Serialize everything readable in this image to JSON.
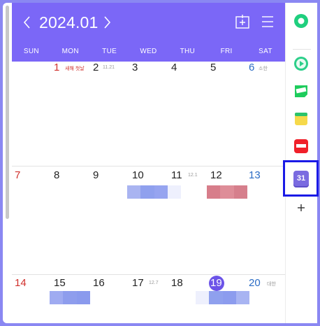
{
  "header": {
    "title": "2024.01",
    "weekdays": [
      "SUN",
      "MON",
      "TUE",
      "WED",
      "THU",
      "FRI",
      "SAT"
    ]
  },
  "weeks": [
    [
      {
        "num": "",
        "sub": ""
      },
      {
        "num": "1",
        "sub": "새해 첫날"
      },
      {
        "num": "2",
        "sub": "11.21"
      },
      {
        "num": "3",
        "sub": ""
      },
      {
        "num": "4",
        "sub": ""
      },
      {
        "num": "5",
        "sub": ""
      },
      {
        "num": "6",
        "sub": "소한"
      }
    ],
    [
      {
        "num": "7",
        "sub": ""
      },
      {
        "num": "8",
        "sub": ""
      },
      {
        "num": "9",
        "sub": ""
      },
      {
        "num": "10",
        "sub": ""
      },
      {
        "num": "11",
        "sub": "12.1"
      },
      {
        "num": "12",
        "sub": ""
      },
      {
        "num": "13",
        "sub": ""
      }
    ],
    [
      {
        "num": "14",
        "sub": ""
      },
      {
        "num": "15",
        "sub": ""
      },
      {
        "num": "16",
        "sub": ""
      },
      {
        "num": "17",
        "sub": "12.7"
      },
      {
        "num": "18",
        "sub": ""
      },
      {
        "num": "19",
        "sub": ""
      },
      {
        "num": "20",
        "sub": "대한"
      }
    ]
  ],
  "today": "19",
  "rail": {
    "selected_badge": "31",
    "items": [
      "green-circle-app-icon",
      "play-app-icon",
      "webtoon-app-icon",
      "memo-app-icon",
      "now-app-icon",
      "calendar-app-icon",
      "add-icon"
    ]
  },
  "colors": {
    "accent": "#7b67f7",
    "background": "#8a87f2",
    "sunday": "#d0302c",
    "saturday": "#2b6cc5",
    "event_blue": "#8fa0ee",
    "event_pink": "#d77d8a"
  }
}
